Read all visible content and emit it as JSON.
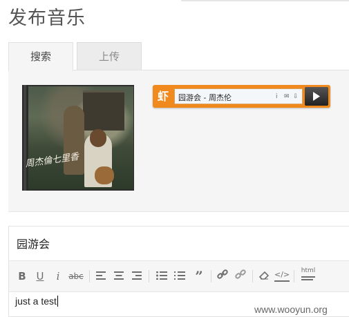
{
  "page": {
    "title": "发布音乐"
  },
  "tabs": [
    {
      "label": "搜索",
      "active": true
    },
    {
      "label": "上传",
      "active": false
    }
  ],
  "album": {
    "calligraphy": "周杰倫七里香"
  },
  "player": {
    "logo": "虾",
    "track": "园游会 - 周杰伦",
    "accent": "#f08a1e",
    "controls": [
      "info-icon",
      "mail-icon",
      "download-icon",
      "play-icon"
    ]
  },
  "editor": {
    "title_value": "园游会",
    "content": "just a test",
    "toolbar": [
      "bold-icon",
      "underline-icon",
      "italic-icon",
      "strikethrough-icon",
      "align-left-icon",
      "align-center-icon",
      "align-right-icon",
      "bullet-list-icon",
      "numbered-list-icon",
      "blockquote-icon",
      "link-icon",
      "unlink-icon",
      "eraser-icon",
      "code-icon",
      "html-icon"
    ],
    "html_label": "html"
  },
  "watermark": "www.wooyun.org"
}
